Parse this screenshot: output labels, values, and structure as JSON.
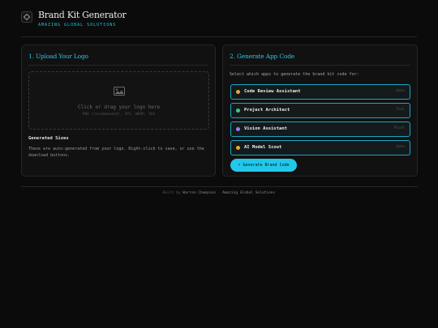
{
  "header": {
    "title": "Brand Kit Generator",
    "subtitle": "AMAZING GLOBAL SOLUTIONS",
    "logo_icon": "diamond-icon"
  },
  "upload_panel": {
    "title": "1. Upload Your Logo",
    "dropzone": {
      "icon": "image-icon",
      "text": "Click or drag your logo here",
      "formats": "PNG (recommended), JPG, WEBP, SVG"
    },
    "generated_title": "Generated Sizes",
    "generated_desc": "These are auto-generated from your logo. Right-click to save, or use the download buttons."
  },
  "code_panel": {
    "title": "2. Generate App Code",
    "prompt": "Select which apps to generate the brand kit code for:",
    "apps": [
      {
        "name": "Code Review Assistant",
        "tag": "Gate",
        "color": "#e6a935"
      },
      {
        "name": "Project Architect",
        "tag": "Tool",
        "color": "#2fd08a"
      },
      {
        "name": "Vision Assistant",
        "tag": "Pivot",
        "color": "#9a7cf0"
      },
      {
        "name": "AI Model Scout",
        "tag": "Gate",
        "color": "#e6a935"
      }
    ],
    "button_label": "⚡ Generate Brand Code"
  },
  "footer": {
    "prefix": "Built by",
    "author": "Warren Champion",
    "separator": " · ",
    "company": "Amazing Global Solutions"
  }
}
